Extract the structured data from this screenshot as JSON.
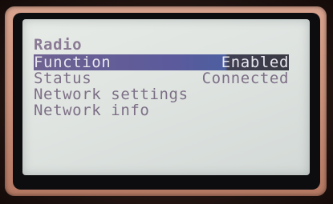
{
  "screen": {
    "title": "Radio",
    "rows": [
      {
        "label": "Function",
        "value": "Enabled",
        "selected": true
      },
      {
        "label": "Status",
        "value": "Connected",
        "selected": false
      },
      {
        "label": "Network settings"
      },
      {
        "label": "Network info"
      }
    ]
  },
  "colors": {
    "lcd_background": "#e2e6e3",
    "text": "#7d6f86",
    "highlight": "#5b5a9c",
    "bezel": "#c9907a"
  }
}
